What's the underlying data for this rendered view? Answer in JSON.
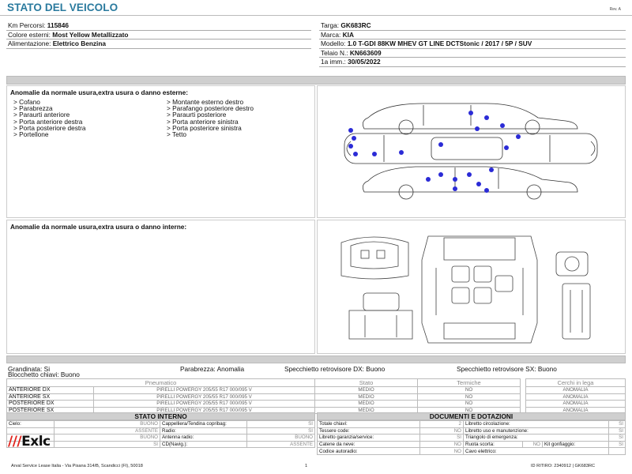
{
  "header": {
    "title": "STATO DEL VEICOLO",
    "rev": "Rev. A"
  },
  "vehicle": {
    "left": [
      {
        "label": "Km Percorsi:",
        "value": "115846"
      },
      {
        "label": "Colore esterni:",
        "value": "Most Yellow Metallizzato"
      },
      {
        "label": "Alimentazione:",
        "value": "Elettrico Benzina"
      }
    ],
    "targa_label": "Targa:",
    "targa": "GK683RC",
    "marca_label": "Marca:",
    "marca": "KIA",
    "modello_label": "Modello:",
    "modello": "1.0 T-GDI 88KW MHEV GT LINE DCTStonic / 2017 / 5P / SUV",
    "telaio_label": "Telaio N.:",
    "telaio": "KN663609",
    "imm_label": "1a imm.:",
    "imm": "30/05/2022"
  },
  "external": {
    "title": "Anomalie da normale usura,extra usura o danno esterne:",
    "col1": [
      "> Cofano",
      "> Parabrezza",
      "> Paraurti anteriore",
      "> Porta anteriore destra",
      "> Porta posteriore destra",
      "> Portellone"
    ],
    "col2": [
      "> Montante esterno destro",
      "> Parafango posteriore destro",
      "> Paraurti posteriore",
      "> Porta anteriore sinistra",
      "> Porta posteriore sinistra",
      "> Tetto"
    ],
    "diagram": "car-exterior-damage-diagram",
    "marker_color": "#2b2bd6"
  },
  "internal": {
    "title": "Anomalie da normale usura,extra usura o danno interne:",
    "diagram": "car-interior-diagram"
  },
  "conditions": {
    "grandinata": "Grandinata: Si",
    "parabrezza": "Parabrezza: Anomalia",
    "specchietto_dx": "Specchietto retrovisore DX: Buono",
    "specchietto_sx": "Specchietto retrovisore SX: Buono",
    "bloccaggio": "Blocchetto chiavi: Buono"
  },
  "tyres": {
    "headers": [
      "Pneumatico",
      "Stato",
      "Termiche",
      "Cerchi in lega"
    ],
    "rows": [
      {
        "pos": "ANTERIORE DX",
        "tyre": "PIRELLI POWERGY 205/55 R17 000/095 V",
        "stato": "MEDIO",
        "termiche": "NO",
        "cerchi": "ANOMALIA"
      },
      {
        "pos": "ANTERIORE SX",
        "tyre": "PIRELLI POWERGY 205/55 R17 000/095 V",
        "stato": "MEDIO",
        "termiche": "NO",
        "cerchi": "ANOMALIA"
      },
      {
        "pos": "POSTERIORE DX",
        "tyre": "PIRELLI POWERGY 205/55 R17 000/095 V",
        "stato": "MEDIO",
        "termiche": "NO",
        "cerchi": "ANOMALIA"
      },
      {
        "pos": "POSTERIORE SX",
        "tyre": "PIRELLI POWERGY 205/55 R17 000/095 V",
        "stato": "MEDIO",
        "termiche": "NO",
        "cerchi": "ANOMALIA"
      }
    ]
  },
  "interior_state": {
    "title": "STATO INTERNO",
    "rows": [
      [
        "Cielo:",
        "BUONO",
        "Cappelliera/Tendina copribag:",
        "SI"
      ],
      [
        "",
        "ASSENTE",
        "Radio:",
        "SI"
      ],
      [
        "",
        "BUONO",
        "Antenna radio:",
        "BUONO"
      ],
      [
        "",
        "SI",
        "CD(Navig.):",
        "ASSENTE"
      ]
    ]
  },
  "documents": {
    "title": "DOCUMENTI E DOTAZIONI",
    "rows": [
      [
        "Totale chiavi:",
        "2",
        "Libretto circolazione:",
        "SI"
      ],
      [
        "Tessere code:",
        "NO",
        "Libretto uso e manutenzione:",
        "SI"
      ],
      [
        "Libretto garanzia/service:",
        "SI",
        "Triangolo di emergenza:",
        "SI"
      ],
      [
        "Catene da neve:",
        "NO",
        "Ruota scorta:",
        "NO",
        "Kit gonfiaggio:",
        "SI"
      ],
      [
        "Codice autoradio:",
        "NO",
        "Cavo elettrico:",
        ""
      ]
    ]
  },
  "footer": {
    "logo_bars": "///",
    "logo_text": "Exlc",
    "address": "Arval Service Lease Italia - Via Pisana 314/B, Scandicci (FI), 50018",
    "page": "1",
    "ref": "ID RITIRO: 2340912 | GK683RC"
  }
}
